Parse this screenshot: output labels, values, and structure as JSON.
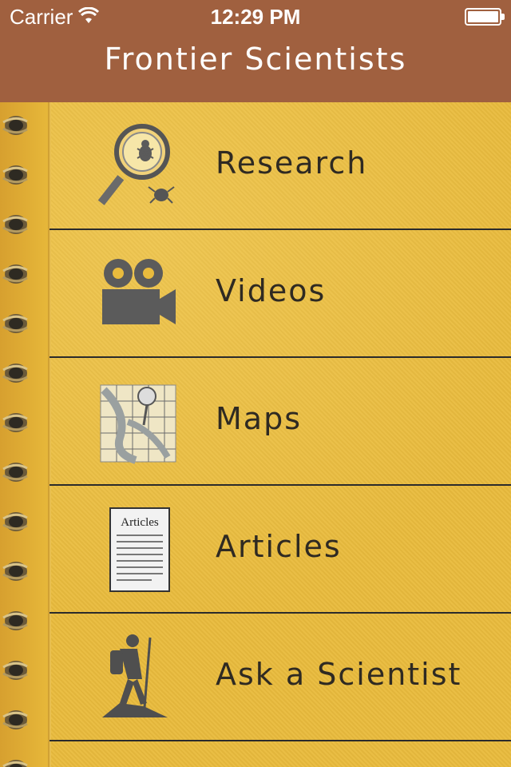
{
  "status_bar": {
    "carrier": "Carrier",
    "time": "12:29 PM",
    "wifi_icon": "wifi-icon",
    "battery_icon": "battery-icon"
  },
  "nav": {
    "title": "Frontier Scientists"
  },
  "menu": {
    "items": [
      {
        "label": "Research",
        "icon": "magnifier-bug-icon"
      },
      {
        "label": "Videos",
        "icon": "movie-camera-icon"
      },
      {
        "label": "Maps",
        "icon": "map-pin-icon"
      },
      {
        "label": "Articles",
        "icon": "articles-document-icon",
        "icon_text": "Articles"
      },
      {
        "label": "Ask a Scientist",
        "icon": "hiker-icon"
      }
    ]
  },
  "colors": {
    "nav_bar": "#a0603f",
    "paper": "#e9bb3d",
    "text": "#2f2a22",
    "divider": "#2b2b2b"
  }
}
